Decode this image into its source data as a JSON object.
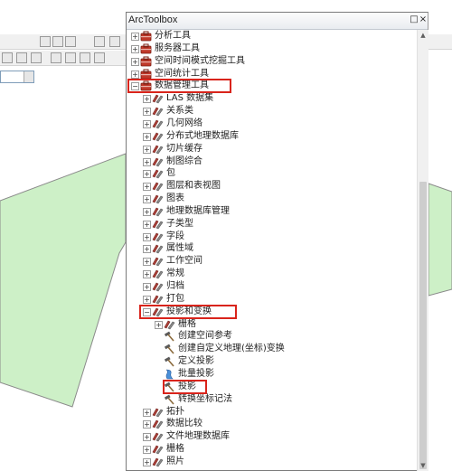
{
  "window": {
    "title": "ArcToolbox"
  },
  "title_buttons": {
    "float": "□",
    "close": "×"
  },
  "background": {
    "polygon_fill": "#cdf0c7",
    "polygon_stroke": "#8a8a8a"
  },
  "tree": [
    {
      "label": "分析工具",
      "level": 0,
      "state": "collapsed",
      "icon": "toolbox-icon"
    },
    {
      "label": "服务器工具",
      "level": 0,
      "state": "collapsed",
      "icon": "toolbox-icon"
    },
    {
      "label": "空间时间模式挖掘工具",
      "level": 0,
      "state": "collapsed",
      "icon": "toolbox-icon"
    },
    {
      "label": "空间统计工具",
      "level": 0,
      "state": "collapsed",
      "icon": "toolbox-icon"
    },
    {
      "label": "数据管理工具",
      "level": 0,
      "state": "expanded",
      "icon": "toolbox-icon"
    },
    {
      "label": "LAS 数据集",
      "level": 1,
      "state": "collapsed",
      "icon": "toolset-icon"
    },
    {
      "label": "关系类",
      "level": 1,
      "state": "collapsed",
      "icon": "toolset-icon"
    },
    {
      "label": "几何网络",
      "level": 1,
      "state": "collapsed",
      "icon": "toolset-icon"
    },
    {
      "label": "分布式地理数据库",
      "level": 1,
      "state": "collapsed",
      "icon": "toolset-icon"
    },
    {
      "label": "切片缓存",
      "level": 1,
      "state": "collapsed",
      "icon": "toolset-icon"
    },
    {
      "label": "制图综合",
      "level": 1,
      "state": "collapsed",
      "icon": "toolset-icon"
    },
    {
      "label": "包",
      "level": 1,
      "state": "collapsed",
      "icon": "toolset-icon"
    },
    {
      "label": "图层和表视图",
      "level": 1,
      "state": "collapsed",
      "icon": "toolset-icon"
    },
    {
      "label": "图表",
      "level": 1,
      "state": "collapsed",
      "icon": "toolset-icon"
    },
    {
      "label": "地理数据库管理",
      "level": 1,
      "state": "collapsed",
      "icon": "toolset-icon"
    },
    {
      "label": "子类型",
      "level": 1,
      "state": "collapsed",
      "icon": "toolset-icon"
    },
    {
      "label": "字段",
      "level": 1,
      "state": "collapsed",
      "icon": "toolset-icon"
    },
    {
      "label": "属性域",
      "level": 1,
      "state": "collapsed",
      "icon": "toolset-icon"
    },
    {
      "label": "工作空间",
      "level": 1,
      "state": "collapsed",
      "icon": "toolset-icon"
    },
    {
      "label": "常规",
      "level": 1,
      "state": "collapsed",
      "icon": "toolset-icon"
    },
    {
      "label": "归档",
      "level": 1,
      "state": "collapsed",
      "icon": "toolset-icon"
    },
    {
      "label": "打包",
      "level": 1,
      "state": "collapsed",
      "icon": "toolset-icon"
    },
    {
      "label": "投影和变换",
      "level": 1,
      "state": "expanded",
      "icon": "toolset-icon"
    },
    {
      "label": "栅格",
      "level": 2,
      "state": "collapsed",
      "icon": "toolset-icon"
    },
    {
      "label": "创建空间参考",
      "level": 2,
      "state": "none",
      "icon": "hammer-icon"
    },
    {
      "label": "创建自定义地理(坐标)变换",
      "level": 2,
      "state": "none",
      "icon": "hammer-icon"
    },
    {
      "label": "定义投影",
      "level": 2,
      "state": "none",
      "icon": "hammer-icon"
    },
    {
      "label": "批量投影",
      "level": 2,
      "state": "none",
      "icon": "script-icon"
    },
    {
      "label": "投影",
      "level": 2,
      "state": "none",
      "icon": "hammer-icon"
    },
    {
      "label": "转换坐标记法",
      "level": 2,
      "state": "none",
      "icon": "hammer-icon"
    },
    {
      "label": "拓扑",
      "level": 1,
      "state": "collapsed",
      "icon": "toolset-icon"
    },
    {
      "label": "数据比较",
      "level": 1,
      "state": "collapsed",
      "icon": "toolset-icon"
    },
    {
      "label": "文件地理数据库",
      "level": 1,
      "state": "collapsed",
      "icon": "toolset-icon"
    },
    {
      "label": "栅格",
      "level": 1,
      "state": "collapsed",
      "icon": "toolset-icon"
    },
    {
      "label": "照片",
      "level": 1,
      "state": "collapsed",
      "icon": "toolset-icon"
    }
  ],
  "highlighted": [
    "数据管理工具",
    "投影和变换",
    "投影"
  ],
  "colors": {
    "highlight": "#d9241b",
    "toolbox_red": "#c0392b"
  }
}
